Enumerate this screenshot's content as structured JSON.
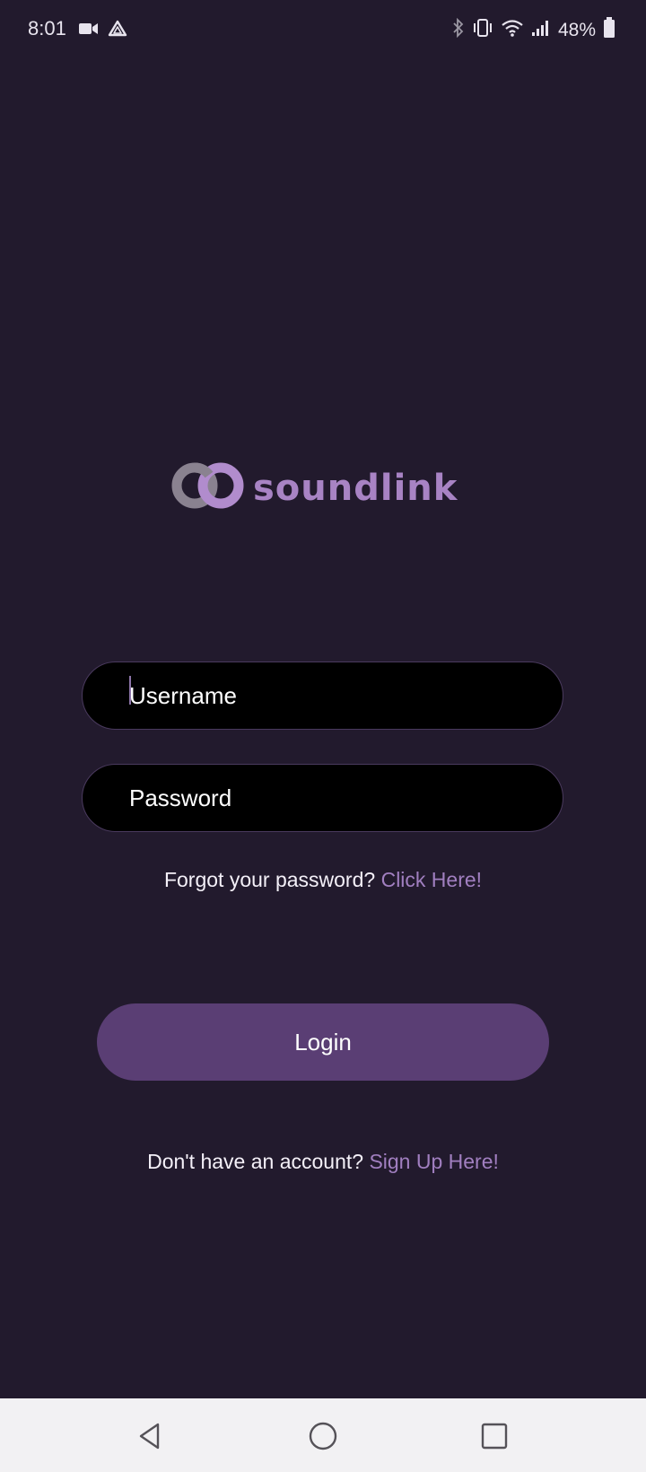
{
  "status_bar": {
    "time": "8:01",
    "battery_percent": "48%",
    "left_icons": [
      "video-camera-icon",
      "drive-icon"
    ],
    "right_icons": [
      "bluetooth-icon",
      "vibrate-icon",
      "wifi-icon",
      "signal-icon",
      "battery-icon"
    ]
  },
  "logo": {
    "text": "soundlink",
    "icon": "linked-rings-logo-icon"
  },
  "form": {
    "username_placeholder": "Username",
    "password_placeholder": "Password",
    "forgot_prefix": "Forgot your password?",
    "forgot_link": "Click Here!",
    "login_label": "Login",
    "signup_prefix": "Don't have an account?",
    "signup_link": "Sign Up Here!"
  },
  "nav_bar": {
    "buttons": [
      "back-icon",
      "home-icon",
      "recents-icon"
    ]
  },
  "colors": {
    "background": "#221a2d",
    "accent": "#a17fc0",
    "button": "#5a3e74",
    "input_bg": "#000000"
  }
}
